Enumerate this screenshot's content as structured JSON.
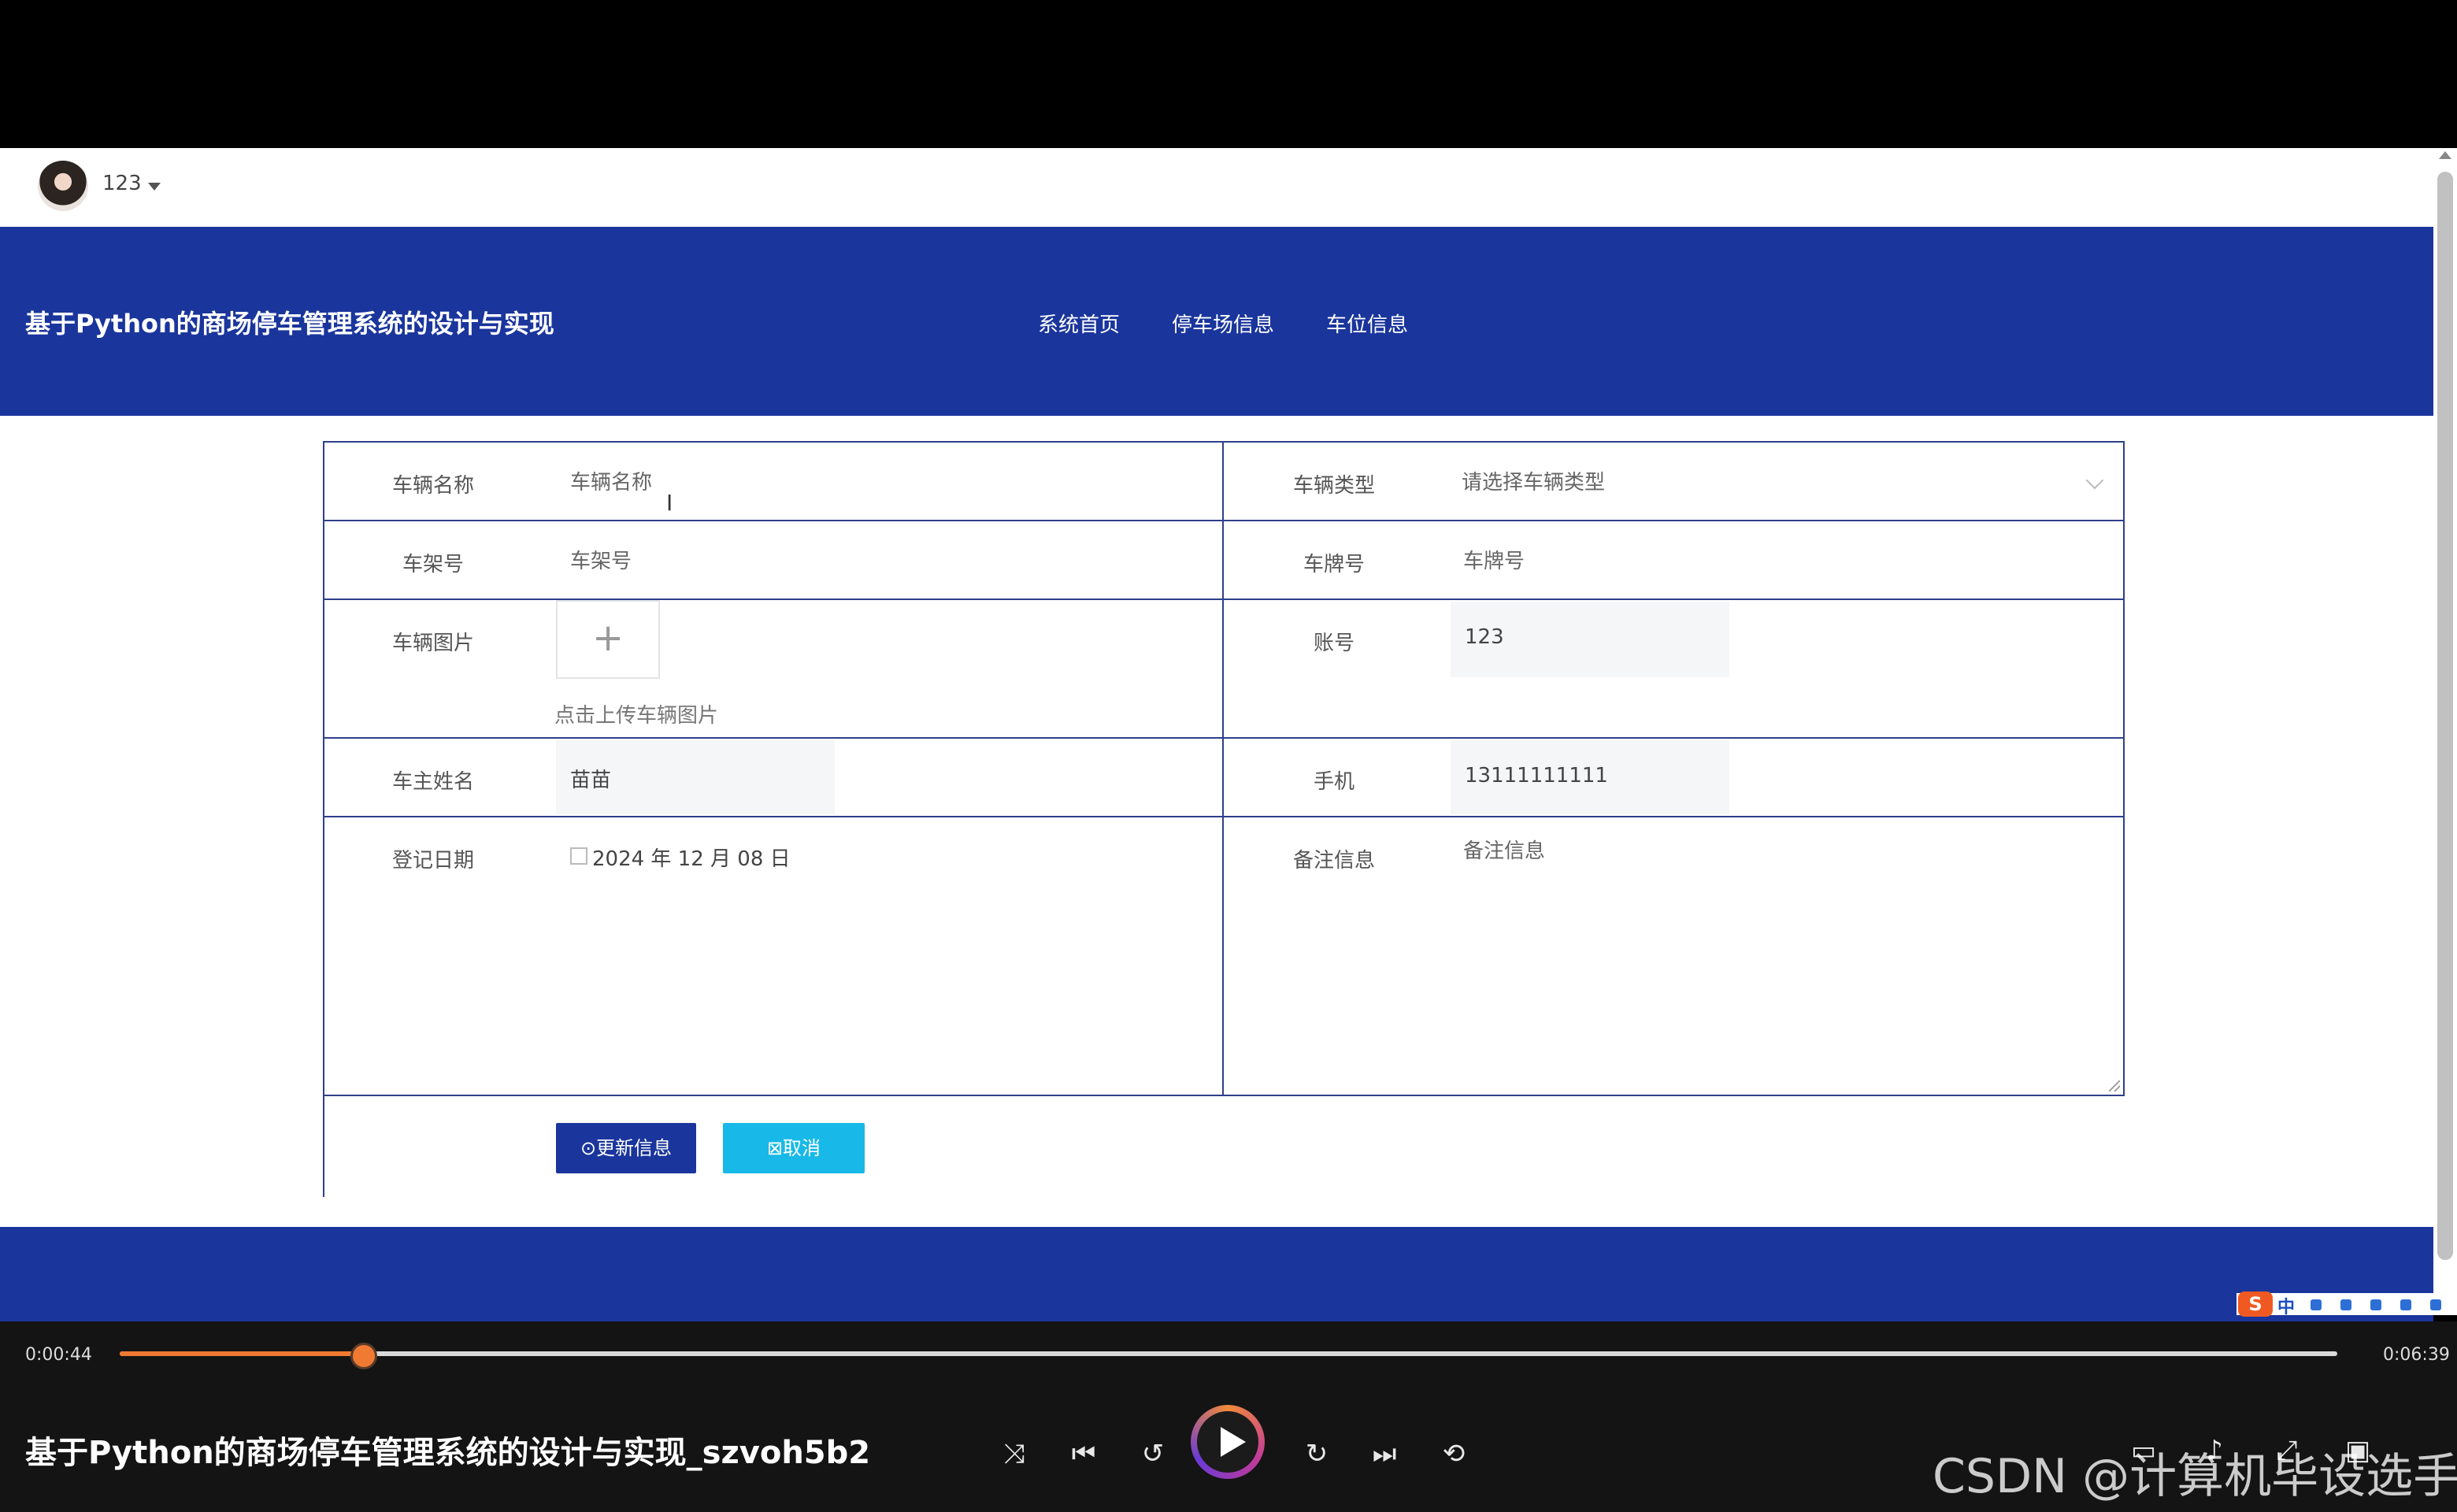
{
  "user": {
    "name": "123"
  },
  "header": {
    "title": "基于Python的商场停车管理系统的设计与实现",
    "nav": [
      "系统首页",
      "停车场信息",
      "车位信息"
    ]
  },
  "form": {
    "vehicle_name": {
      "label": "车辆名称",
      "placeholder": "车辆名称"
    },
    "vehicle_type": {
      "label": "车辆类型",
      "placeholder": "请选择车辆类型"
    },
    "frame_no": {
      "label": "车架号",
      "placeholder": "车架号"
    },
    "plate_no": {
      "label": "车牌号",
      "placeholder": "车牌号"
    },
    "vehicle_image": {
      "label": "车辆图片",
      "hint": "点击上传车辆图片"
    },
    "account": {
      "label": "账号",
      "value": "123"
    },
    "owner_name": {
      "label": "车主姓名",
      "value": "苗苗"
    },
    "phone": {
      "label": "手机",
      "value": "13111111111"
    },
    "register_date": {
      "label": "登记日期",
      "value": "2024 年 12 月 08 日"
    },
    "remark": {
      "label": "备注信息",
      "placeholder": "备注信息"
    },
    "update_button": "⊙更新信息",
    "cancel_button": "⊠取消"
  },
  "player": {
    "current_time": "0:00:44",
    "total_time": "0:06:39",
    "progress": 0.11,
    "title": "基于Python的商场停车管理系统的设计与实现_szvoh5b2"
  },
  "ime": {
    "label": "中"
  },
  "watermark": "CSDN @计算机毕设选手",
  "colors": {
    "header_bg": "#1a359c",
    "primary": "#1a359c",
    "cancel": "#18b9e8",
    "progress": "#f07a32"
  }
}
